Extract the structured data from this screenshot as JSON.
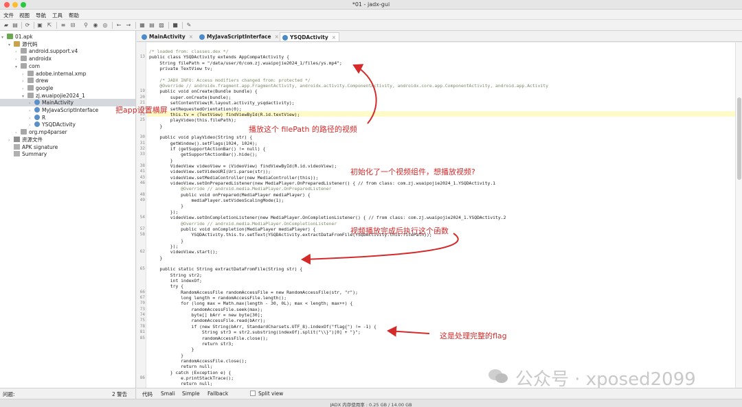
{
  "window": {
    "title": "*01 - jadx-gui"
  },
  "menu": [
    "文件",
    "视图",
    "导航",
    "工具",
    "帮助"
  ],
  "toolbar": {
    "icons": [
      "open-icon",
      "save-icon",
      "sync-icon",
      "save-all-icon",
      "export-icon",
      "expand-icon",
      "collapse-icon",
      "search-icon",
      "class-search-icon",
      "usage-icon",
      "back-icon",
      "forward-icon",
      "decompile-icon",
      "log-icon",
      "stop-icon",
      "settings-icon"
    ]
  },
  "tree": {
    "items": [
      {
        "label": "01.apk",
        "depth": 0,
        "icon": "apk",
        "arrow": "▾"
      },
      {
        "label": "源代码",
        "depth": 1,
        "icon": "src",
        "arrow": "▾"
      },
      {
        "label": "android.support.v4",
        "depth": 2,
        "icon": "pkg",
        "arrow": "›"
      },
      {
        "label": "androidx",
        "depth": 2,
        "icon": "pkg",
        "arrow": "›"
      },
      {
        "label": "com",
        "depth": 2,
        "icon": "pkg",
        "arrow": "▾"
      },
      {
        "label": "adobe.internal.xmp",
        "depth": 3,
        "icon": "pkg",
        "arrow": "›"
      },
      {
        "label": "drew",
        "depth": 3,
        "icon": "pkg",
        "arrow": "›"
      },
      {
        "label": "google",
        "depth": 3,
        "icon": "pkg",
        "arrow": "›"
      },
      {
        "label": "zj.wuaipojie2024_1",
        "depth": 3,
        "icon": "pkg",
        "arrow": "▾"
      },
      {
        "label": "MainActivity",
        "depth": 4,
        "icon": "cls",
        "arrow": "›",
        "selected": true
      },
      {
        "label": "MyJavaScriptInterface",
        "depth": 4,
        "icon": "cls",
        "arrow": "›"
      },
      {
        "label": "R",
        "depth": 4,
        "icon": "cls",
        "arrow": "›"
      },
      {
        "label": "YSQDActivity",
        "depth": 4,
        "icon": "cls",
        "arrow": "›"
      },
      {
        "label": "org.mp4parser",
        "depth": 2,
        "icon": "pkg",
        "arrow": "›"
      },
      {
        "label": "资源文件",
        "depth": 1,
        "icon": "res",
        "arrow": "›"
      },
      {
        "label": "APK signature",
        "depth": 1,
        "icon": "doc",
        "arrow": ""
      },
      {
        "label": "Summary",
        "depth": 1,
        "icon": "doc",
        "arrow": ""
      }
    ]
  },
  "tabs": [
    {
      "label": "MainActivity",
      "active": false
    },
    {
      "label": "MyJavaScriptInterface",
      "active": false
    },
    {
      "label": "YSQDActivity",
      "active": true
    }
  ],
  "code": {
    "lines": [
      {
        "n": "",
        "text": "/* loaded from: classes.dex */"
      },
      {
        "n": "13",
        "text": "public class YSQDActivity extends AppCompatActivity {"
      },
      {
        "n": "",
        "text": "    String filePath = \"/data/user/0/com.zj.wuaipojie2024_1/files/ys.mp4\";"
      },
      {
        "n": "",
        "text": "    private TextView tv;"
      },
      {
        "n": "",
        "text": ""
      },
      {
        "n": "",
        "text": "    /* JADX INFO: Access modifiers changed from: protected */"
      },
      {
        "n": "",
        "text": "    @Override // androidx.fragment.app.FragmentActivity, androidx.activity.ComponentActivity, androidx.core.app.ComponentActivity, android.app.Activity"
      },
      {
        "n": "19",
        "text": "    public void onCreate(Bundle bundle) {"
      },
      {
        "n": "20",
        "text": "        super.onCreate(bundle);"
      },
      {
        "n": "21",
        "text": "        setContentView(R.layout.activity_ysqdactivity);"
      },
      {
        "n": "22",
        "text": "        setRequestedOrientation(0);"
      },
      {
        "n": "23",
        "text": "        this.tv = (TextView) findViewById(R.id.textView);"
      },
      {
        "n": "25",
        "text": "        playVideo(this.filePath);"
      },
      {
        "n": "",
        "text": "    }"
      },
      {
        "n": "",
        "text": ""
      },
      {
        "n": "30",
        "text": "    public void playVideo(String str) {"
      },
      {
        "n": "31",
        "text": "        getWindow().setFlags(1024, 1024);"
      },
      {
        "n": "32",
        "text": "        if (getSupportActionBar() != null) {"
      },
      {
        "n": "33",
        "text": "            getSupportActionBar().hide();"
      },
      {
        "n": "",
        "text": "        }"
      },
      {
        "n": "38",
        "text": "        VideoView videoView = (VideoView) findViewById(R.id.videoView);"
      },
      {
        "n": "41",
        "text": "        videoView.setVideoURI(Uri.parse(str));"
      },
      {
        "n": "43",
        "text": "        videoView.setMediaController(new MediaController(this));"
      },
      {
        "n": "46",
        "text": "        videoView.setOnPreparedListener(new MediaPlayer.OnPreparedListener() { // from class: com.zj.wuaipojie2024_1.YSQDActivity.1"
      },
      {
        "n": "",
        "text": "            @Override // android.media.MediaPlayer.OnPreparedListener"
      },
      {
        "n": "48",
        "text": "            public void onPrepared(MediaPlayer mediaPlayer) {"
      },
      {
        "n": "49",
        "text": "                mediaPlayer.setVideoScalingMode(1);"
      },
      {
        "n": "",
        "text": "            }"
      },
      {
        "n": "",
        "text": "        });"
      },
      {
        "n": "54",
        "text": "        videoView.setOnCompletionListener(new MediaPlayer.OnCompletionListener() { // from class: com.zj.wuaipojie2024_1.YSQDActivity.2"
      },
      {
        "n": "",
        "text": "            @Override // android.media.MediaPlayer.OnCompletionListener"
      },
      {
        "n": "57",
        "text": "            public void onCompletion(MediaPlayer mediaPlayer) {"
      },
      {
        "n": "58",
        "text": "                YSQDActivity.this.tv.setText(YSQDActivity.extractDataFromFile(YSQDActivity.this.filePath));"
      },
      {
        "n": "",
        "text": "            }"
      },
      {
        "n": "",
        "text": "        });"
      },
      {
        "n": "62",
        "text": "        videoView.start();"
      },
      {
        "n": "",
        "text": "    }"
      },
      {
        "n": "",
        "text": ""
      },
      {
        "n": "65",
        "text": "    public static String extractDataFromFile(String str) {"
      },
      {
        "n": "",
        "text": "        String str2;"
      },
      {
        "n": "",
        "text": "        int indexOf;"
      },
      {
        "n": "",
        "text": "        try {"
      },
      {
        "n": "66",
        "text": "            RandomAccessFile randomAccessFile = new RandomAccessFile(str, \"r\");"
      },
      {
        "n": "67",
        "text": "            long length = randomAccessFile.length();"
      },
      {
        "n": "70",
        "text": "            for (long max = Math.max(length - 30, 0L); max < length; max++) {"
      },
      {
        "n": "73",
        "text": "                randomAccessFile.seek(max);"
      },
      {
        "n": "74",
        "text": "                byte[] bArr = new byte[30];"
      },
      {
        "n": "75",
        "text": "                randomAccessFile.read(bArr);"
      },
      {
        "n": "78",
        "text": "                if (new String(bArr, StandardCharsets.UTF_8).indexOf(\"flag{\") != -1) {"
      },
      {
        "n": "81",
        "text": "                    String str3 = str2.substring(indexOf).split(\"\\\\}\")[0] + \"}\";"
      },
      {
        "n": "85",
        "text": "                    randomAccessFile.close();"
      },
      {
        "n": "",
        "text": "                    return str3;"
      },
      {
        "n": "",
        "text": "                }"
      },
      {
        "n": "",
        "text": "            }"
      },
      {
        "n": "",
        "text": "            randomAccessFile.close();"
      },
      {
        "n": "",
        "text": "            return null;"
      },
      {
        "n": "",
        "text": "        } catch (Exception e) {"
      },
      {
        "n": "86",
        "text": "            e.printStackTrace();"
      },
      {
        "n": "",
        "text": "            return null;"
      }
    ]
  },
  "annotations": {
    "landscape": "把app设置横屏",
    "play_path": "播放这个 filePath 的路径的视频",
    "init_video": "初始化了一个视频组件，想播放视频?",
    "on_complete": "视频播放完成后执行这个函数",
    "flag_done": "这是处理完整的flag",
    "color": "#d42a2a"
  },
  "bottom_tabs": {
    "code": "代码",
    "smali": "Smali",
    "simple": "Simple",
    "fallback": "Fallback",
    "split": "Split view"
  },
  "status": {
    "issues_label": "问题:",
    "warnings": "2 警告",
    "memory": "JADX 内存使用率 : 0.25 GB / 14.00 GB"
  },
  "watermark": "公众号 · xposed2099"
}
